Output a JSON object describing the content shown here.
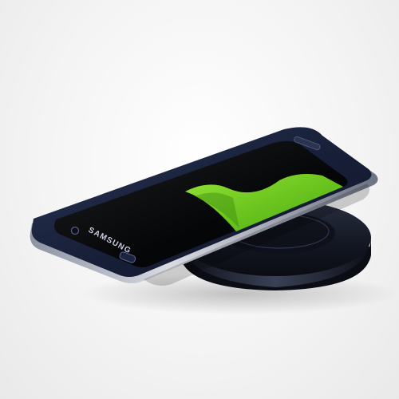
{
  "product": {
    "brand_mark": "SAMSUNG"
  },
  "colors": {
    "background": "#f2f2f2",
    "phone_frame": "#1b2236",
    "screen": "#050608",
    "screen_accent_green": "#6fcf1f",
    "charging_pad": "#161a25"
  },
  "icons": {
    "home_button": "home-button-icon",
    "front_camera": "front-camera-icon"
  }
}
